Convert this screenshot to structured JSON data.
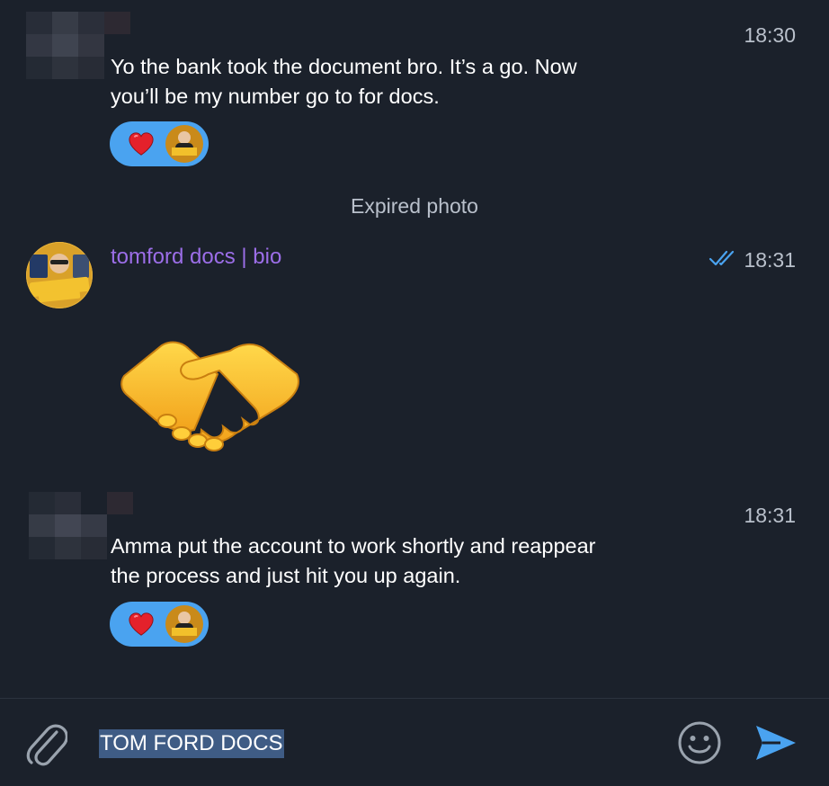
{
  "messages": [
    {
      "time": "18:30",
      "text_line1": "Yo the bank took the document bro. It’s a go. Now",
      "text_line2": "you’ll be my number go to for docs.",
      "reaction": "heart"
    },
    {
      "service": "Expired photo"
    },
    {
      "sender": "tomford docs | bio",
      "time": "18:31",
      "status": "read",
      "sticker": "handshake"
    },
    {
      "time": "18:31",
      "text_line1": "Amma put the account to work shortly and reappear",
      "text_line2": "the process and just hit you up again.",
      "reaction": "heart"
    }
  ],
  "composer": {
    "input_value": "TOM FORD DOCS",
    "attach_icon": "paperclip-icon",
    "emoji_icon": "smiley-icon",
    "send_icon": "send-icon"
  },
  "colors": {
    "background": "#1b212b",
    "accent": "#4aa3f0",
    "sender_name": "#9c6ee8",
    "selection": "#3f5c85"
  }
}
